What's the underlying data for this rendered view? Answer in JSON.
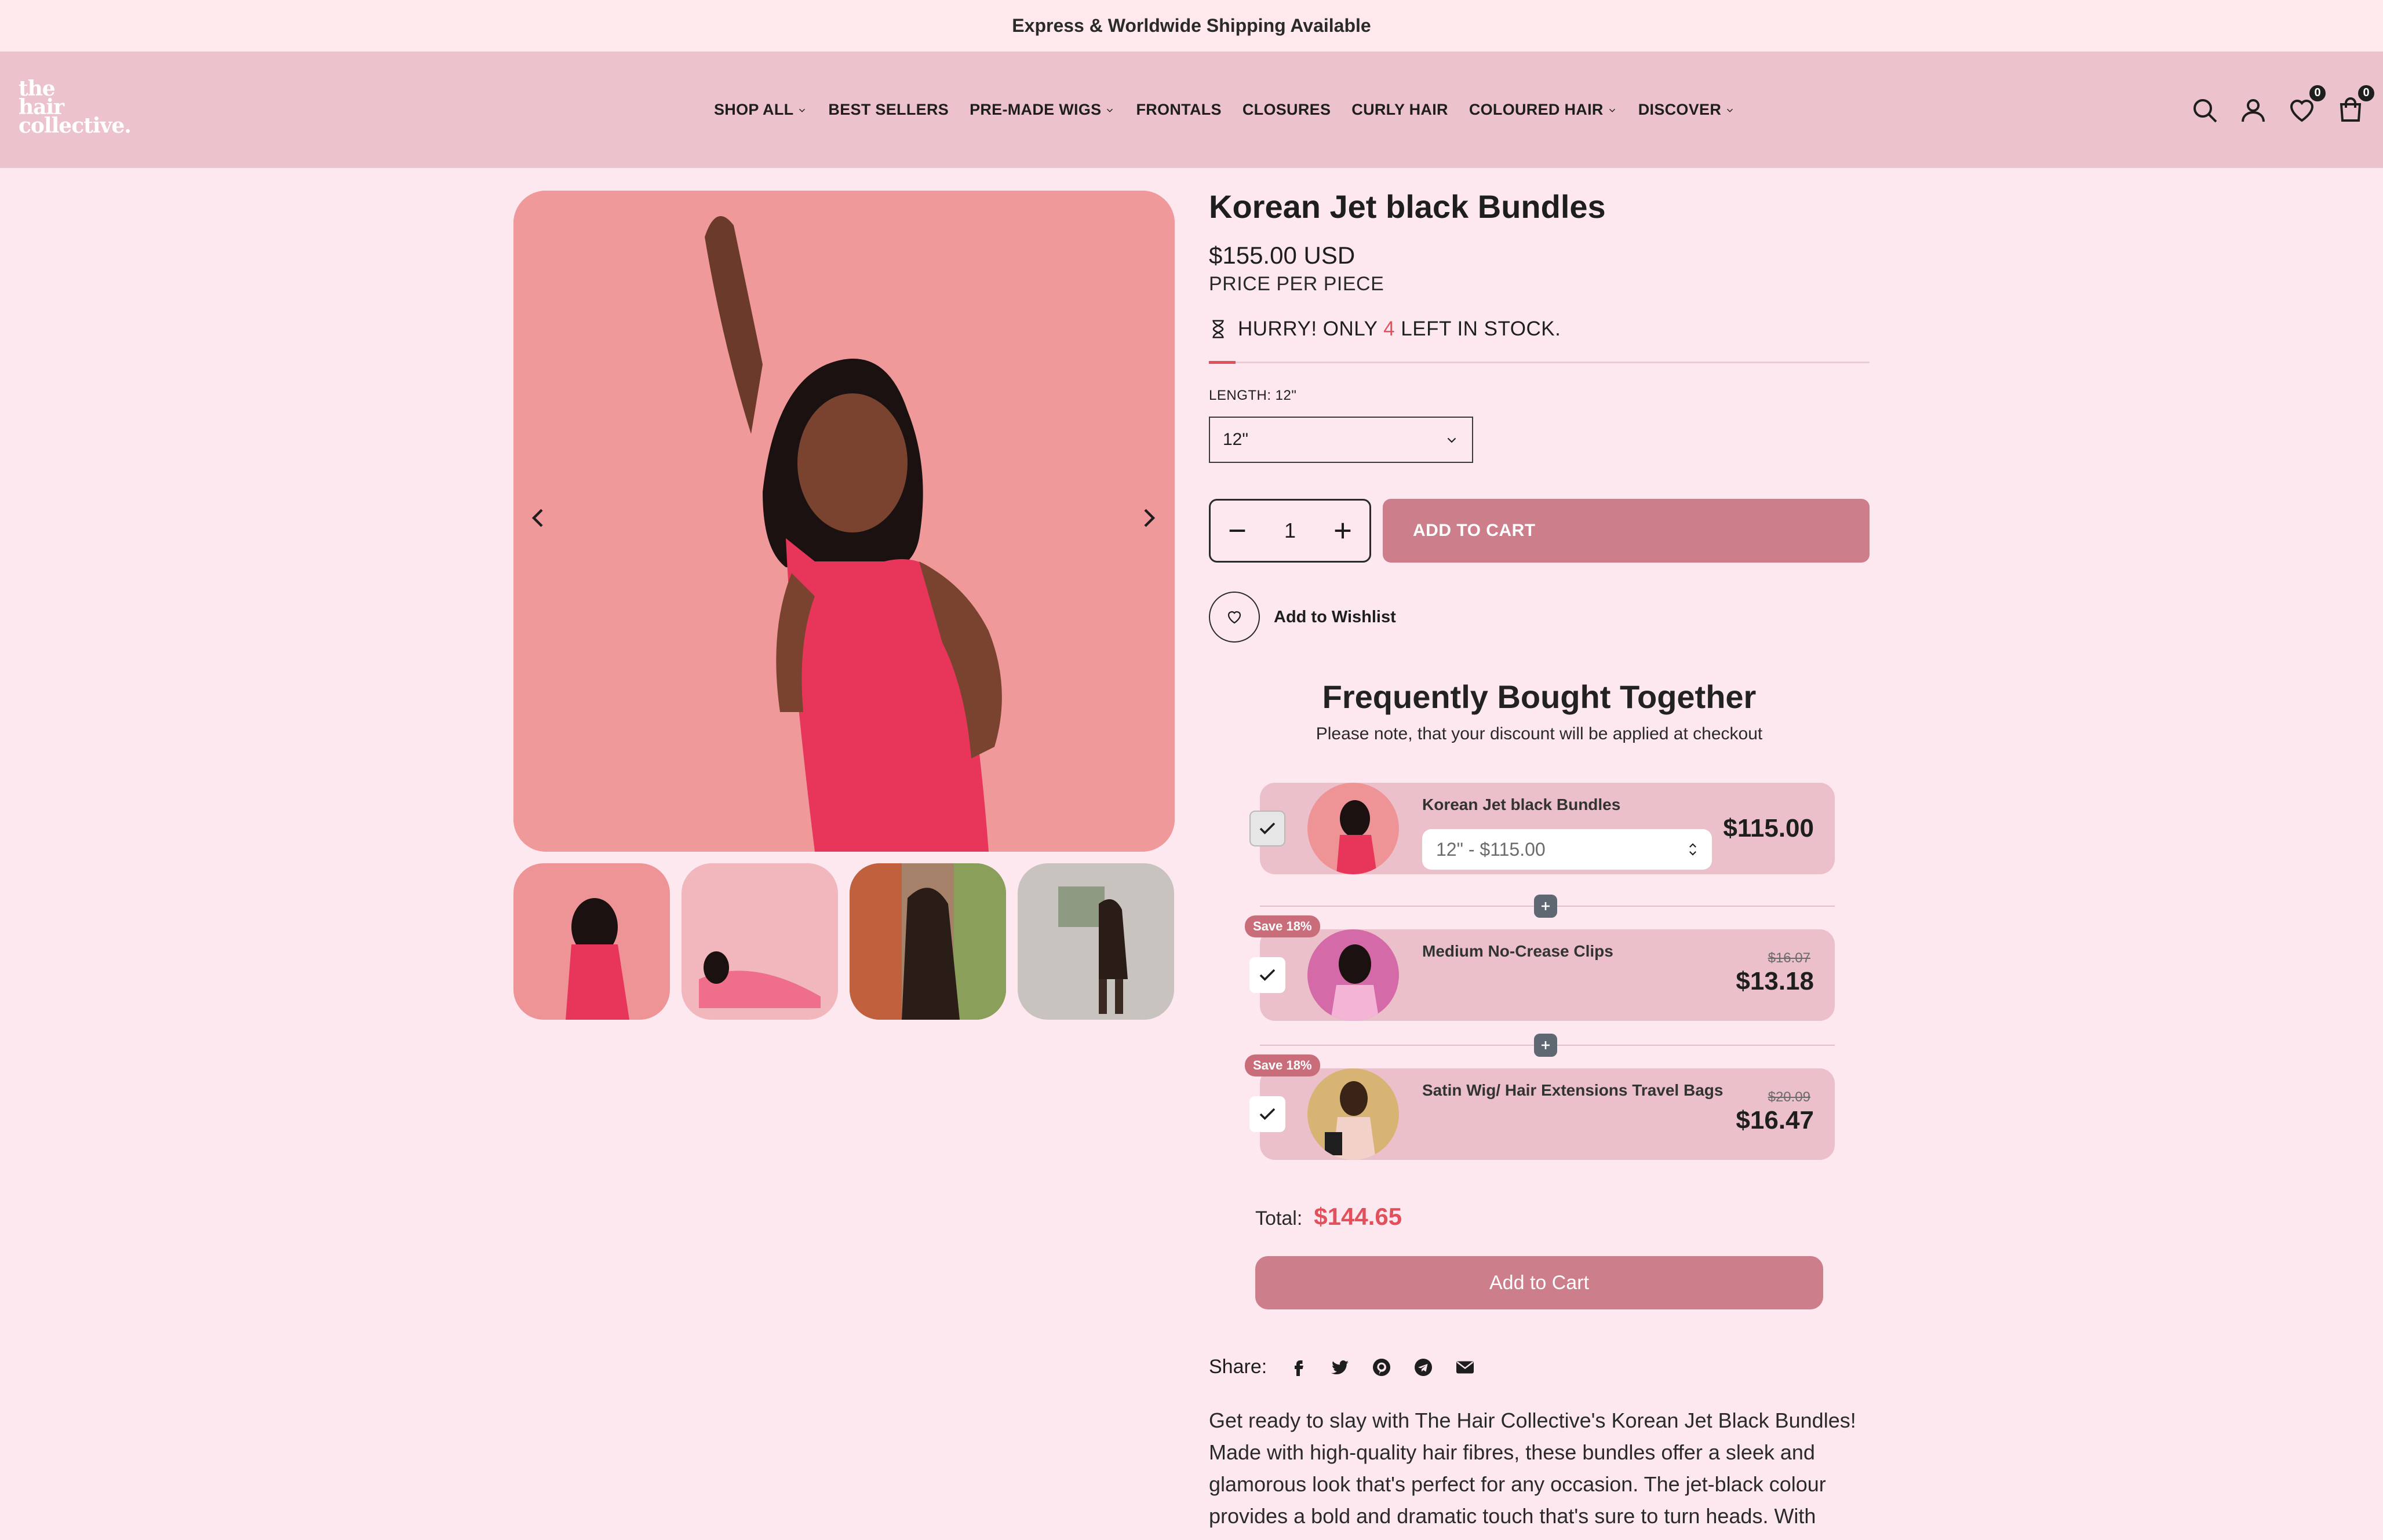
{
  "announcement": "Express & Worldwide Shipping Available",
  "logo": {
    "line1": "the",
    "line2": "hair",
    "line3": "collective."
  },
  "nav": [
    {
      "label": "SHOP ALL",
      "dropdown": true
    },
    {
      "label": "BEST SELLERS",
      "dropdown": false
    },
    {
      "label": "PRE-MADE WIGS",
      "dropdown": true
    },
    {
      "label": "FRONTALS",
      "dropdown": false
    },
    {
      "label": "CLOSURES",
      "dropdown": false
    },
    {
      "label": "CURLY HAIR",
      "dropdown": false
    },
    {
      "label": "COLOURED HAIR",
      "dropdown": true
    },
    {
      "label": "DISCOVER",
      "dropdown": true
    }
  ],
  "header_icons": {
    "wishlist_count": "0",
    "cart_count": "0"
  },
  "product": {
    "title": "Korean Jet black Bundles",
    "price": "$155.00 USD",
    "price_note": "PRICE PER PIECE",
    "stock_prefix": "HURRY! ONLY",
    "stock_count": "4",
    "stock_suffix": "LEFT IN STOCK.",
    "length_label": "LENGTH: 12\"",
    "length_value": "12\"",
    "quantity": "1",
    "add_to_cart": "ADD TO CART",
    "wishlist": "Add to Wishlist"
  },
  "fbt": {
    "title": "Frequently Bought Together",
    "subtitle": "Please note, that your discount will be applied at checkout",
    "items": [
      {
        "name": "Korean Jet black Bundles",
        "variant": "12\" - $115.00",
        "price": "$115.00",
        "checked": true
      },
      {
        "name": "Medium No-Crease Clips",
        "badge": "Save 18%",
        "old_price": "$16.07",
        "price": "$13.18",
        "checked": true
      },
      {
        "name": "Satin Wig/ Hair Extensions Travel Bags",
        "badge": "Save 18%",
        "old_price": "$20.09",
        "price": "$16.47",
        "checked": true
      }
    ],
    "total_label": "Total:",
    "total_value": "$144.65",
    "add_label": "Add to Cart"
  },
  "share_label": "Share:",
  "description": "Get ready to slay with The Hair Collective's Korean Jet Black Bundles! Made with high-quality hair fibres, these bundles offer a sleek and glamorous look that's perfect for any occasion. The jet-black colour provides a bold and dramatic touch that's sure to turn heads. With",
  "colors": {
    "accent": "#cc7e8b",
    "header_bg": "#ecc3cd",
    "page_bg": "#fde8ef",
    "sale": "#e2505c"
  }
}
